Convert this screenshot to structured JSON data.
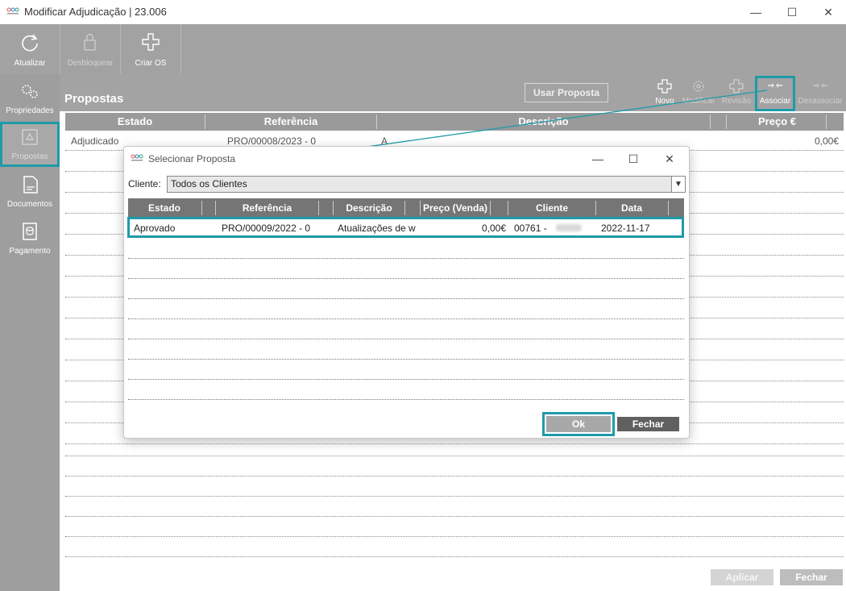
{
  "window": {
    "title": "Modificar Adjudicação | 23.006"
  },
  "toolbar": {
    "atualizar": "Atualizar",
    "desbloquear": "Desbloquear",
    "criar_os": "Criar OS"
  },
  "sidebar": {
    "items": [
      {
        "label": "Propriedades",
        "icon": "gears-icon"
      },
      {
        "label": "Propostas",
        "icon": "proposal-icon"
      },
      {
        "label": "Documentos",
        "icon": "document-icon"
      },
      {
        "label": "Pagamento",
        "icon": "payment-icon"
      }
    ]
  },
  "main": {
    "title": "Propostas",
    "usar_proposta": "Usar Proposta",
    "actions": {
      "novo": "Novo",
      "modificar": "Modificar",
      "revisao": "Revisão",
      "associar": "Associar",
      "desassociar": "Desassociar"
    },
    "columns": [
      "Estado",
      "Referência",
      "Descrição",
      "Preço €"
    ],
    "rows": [
      {
        "estado": "Adjudicado",
        "referencia": "PRO/00008/2023 - 0",
        "descricao": "A",
        "preco": "0,00€"
      }
    ],
    "aplicar": "Aplicar",
    "fechar": "Fechar"
  },
  "dialog": {
    "title": "Selecionar Proposta",
    "cliente_label": "Cliente:",
    "cliente_value": "Todos os Clientes",
    "columns": [
      "Estado",
      "Referência",
      "Descrição",
      "Preço (Venda)",
      "Cliente",
      "Data"
    ],
    "rows": [
      {
        "estado": "Aprovado",
        "referencia": "PRO/00009/2022 - 0",
        "descricao": "Atualizações de w",
        "preco": "0,00€",
        "cliente": "00761 -",
        "data": "2022-11-17"
      }
    ],
    "ok": "Ok",
    "fechar": "Fechar"
  },
  "colors": {
    "accent": "#1f9aa8",
    "toolbar": "#a2a2a2",
    "sidebar": "#9e9e9e",
    "dialog_header": "#757575"
  }
}
